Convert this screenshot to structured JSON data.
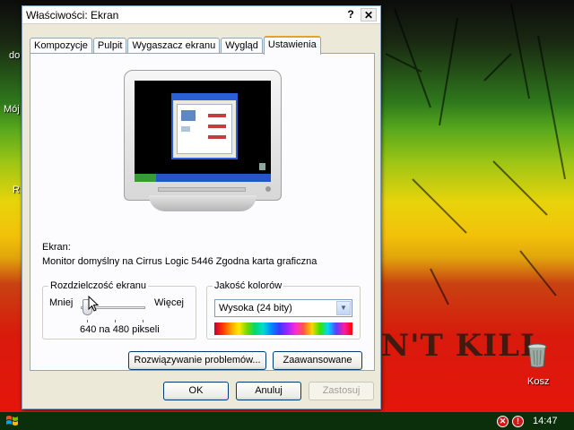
{
  "desktop": {
    "left_labels": [
      "do",
      "Mój",
      "R"
    ],
    "wall_text": "N'T KILL",
    "recycle_bin_label": "Kosz"
  },
  "window": {
    "title": "Właściwości: Ekran",
    "help_button": "?",
    "close_button": "✕",
    "tabs": [
      {
        "label": "Kompozycje",
        "active": false
      },
      {
        "label": "Pulpit",
        "active": false
      },
      {
        "label": "Wygaszacz ekranu",
        "active": false
      },
      {
        "label": "Wygląd",
        "active": false
      },
      {
        "label": "Ustawienia",
        "active": true
      }
    ],
    "display_label": "Ekran:",
    "display_value": "Monitor domyślny na Cirrus Logic 5446 Zgodna karta graficzna",
    "resolution": {
      "title": "Rozdzielczość ekranu",
      "less": "Mniej",
      "more": "Więcej",
      "value": "640 na 480 pikseli",
      "slider_position": 0
    },
    "color_quality": {
      "title": "Jakość kolorów",
      "selected": "Wysoka (24 bity)"
    },
    "buttons": {
      "troubleshoot": "Rozwiązywanie problemów...",
      "advanced": "Zaawansowane",
      "ok": "OK",
      "cancel": "Anuluj",
      "apply": "Zastosuj"
    }
  },
  "taskbar": {
    "clock": "14:47"
  },
  "colors": {
    "tab_accent": "#e89f2c",
    "button_border": "#003c74",
    "taskbar": "#0b2e0b"
  }
}
